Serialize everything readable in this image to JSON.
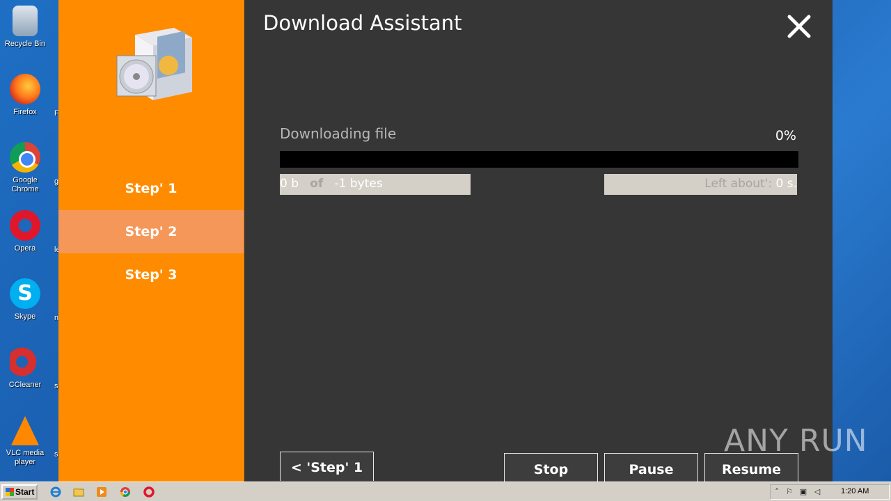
{
  "desktop": {
    "icons": [
      {
        "label": "Recycle Bin"
      },
      {
        "label": "Firefox"
      },
      {
        "label": "Google Chrome"
      },
      {
        "label": "Opera"
      },
      {
        "label": "Skype"
      },
      {
        "label": "CCleaner"
      },
      {
        "label": "VLC media player"
      }
    ],
    "partial_labels": [
      "F",
      "g",
      "le",
      "n",
      "si",
      "s"
    ]
  },
  "installer": {
    "title": "Download Assistant",
    "steps": [
      "Step' 1",
      "Step' 2",
      "Step' 3"
    ],
    "active_step": 1,
    "status_label": "Downloading file",
    "percent_text": "0%",
    "progress": 0,
    "bytes_done": "0 b",
    "bytes_of": "of",
    "bytes_total": "-1 bytes",
    "left_about_label": "Left about':",
    "left_about_value": "0 s.",
    "buttons": {
      "back": "< 'Step' 1",
      "stop": "Stop",
      "pause": "Pause",
      "resume": "Resume"
    }
  },
  "watermark": "ANY RUN",
  "taskbar": {
    "start_label": "Start",
    "clock": "1:20 AM"
  },
  "colors": {
    "sidebar": "#ff8c00",
    "active_step": "#f6975a",
    "panel": "#363636"
  }
}
